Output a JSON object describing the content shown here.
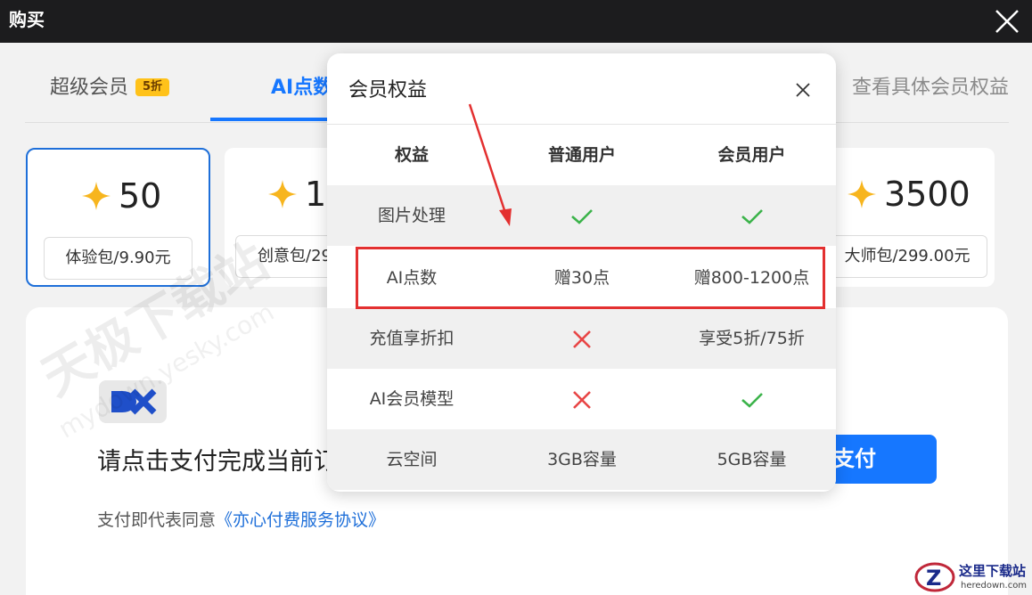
{
  "window": {
    "title": "购买"
  },
  "tabs": {
    "super_vip": {
      "label": "超级会员",
      "badge": "5折"
    },
    "ai_points": {
      "label": "AI点数"
    },
    "view_benefits": "查看具体会员权益"
  },
  "packages": [
    {
      "amount": "50",
      "label": "体验包/9.90元"
    },
    {
      "amount": "1",
      "label": "创意包/29"
    },
    {
      "amount": "3500",
      "label": "大师包/299.00元"
    }
  ],
  "payment": {
    "prompt": "请点击支付完成当前订",
    "button": "支付",
    "agree_prefix": "支付即代表同意",
    "agree_link": "《亦心付费服务协议》"
  },
  "modal": {
    "title": "会员权益",
    "headers": [
      "权益",
      "普通用户",
      "会员用户"
    ],
    "rows": [
      {
        "name": "图片处理",
        "normal": "check",
        "member": "check"
      },
      {
        "name": "AI点数",
        "normal": "赠30点",
        "member": "赠800-1200点"
      },
      {
        "name": "充值享折扣",
        "normal": "cross",
        "member": "享受5折/75折"
      },
      {
        "name": "AI会员模型",
        "normal": "cross",
        "member": "check"
      },
      {
        "name": "云空间",
        "normal": "3GB容量",
        "member": "5GB容量"
      }
    ]
  },
  "watermark": {
    "text": "天极下载站",
    "url": "mydown.yesky.com",
    "corner_name": "这里下载站",
    "corner_url": "heredown.com"
  },
  "colors": {
    "accent": "#1677ff",
    "check": "#3bb34a",
    "cross": "#e84545",
    "annotation": "#e33030",
    "badge": "#ffc21a"
  }
}
